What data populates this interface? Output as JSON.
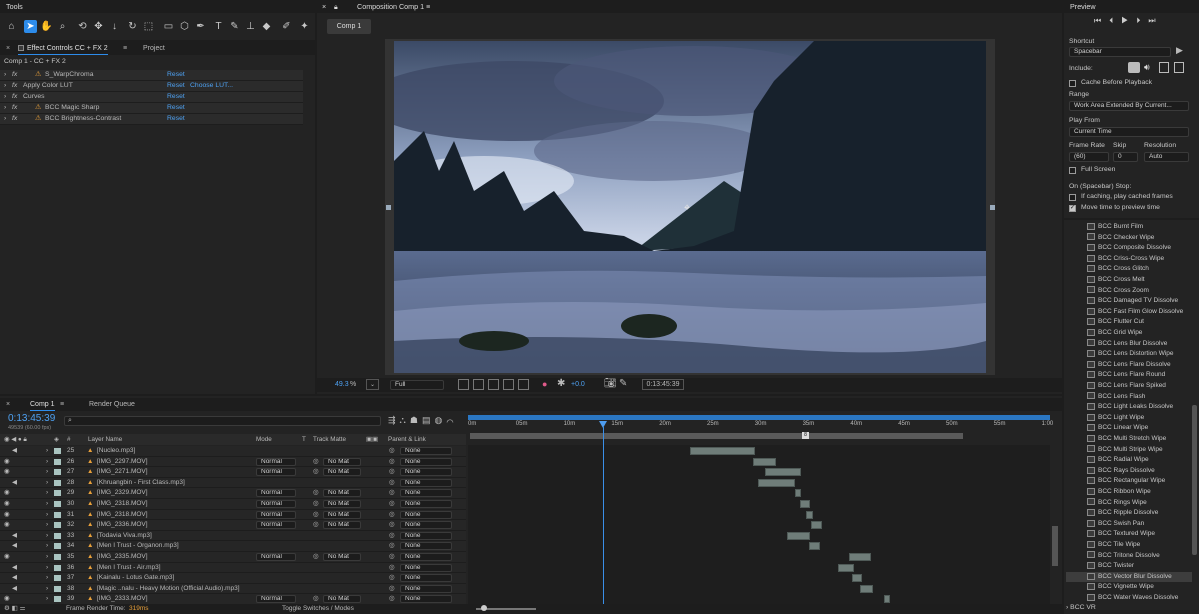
{
  "tools": {
    "title": "Tools"
  },
  "effect_controls": {
    "close": "×",
    "tab": "Effect Controls CC + FX 2",
    "menu": "≡",
    "project_tab": "Project",
    "breadcrumb": "Comp 1 - CC + FX 2",
    "effects": [
      {
        "name": "S_WarpChroma",
        "warn": true,
        "reset": "Reset",
        "extra": ""
      },
      {
        "name": "Apply Color LUT",
        "warn": false,
        "reset": "Reset",
        "extra": "Choose LUT..."
      },
      {
        "name": "Curves",
        "warn": false,
        "reset": "Reset",
        "extra": ""
      },
      {
        "name": "BCC Magic Sharp",
        "warn": true,
        "reset": "Reset",
        "extra": ""
      },
      {
        "name": "BCC Brightness-Contrast",
        "warn": true,
        "reset": "Reset",
        "extra": ""
      }
    ]
  },
  "composition": {
    "tab": "Composition Comp 1",
    "menu": "≡",
    "subtab": "Comp 1",
    "zoom": "49.3",
    "zoom_unit": "%",
    "resolution": "Full",
    "exposure": "+0.0",
    "timecode": "0:13:45:39"
  },
  "preview": {
    "title": "Preview",
    "shortcut_label": "Shortcut",
    "shortcut_value": "Spacebar",
    "include_label": "Include:",
    "cache_label": "Cache Before Playback",
    "range_label": "Range",
    "range_value": "Work Area Extended By Current...",
    "play_from_label": "Play From",
    "play_from_value": "Current Time",
    "frame_rate_label": "Frame Rate",
    "skip_label": "Skip",
    "resolution_label": "Resolution",
    "frame_rate_value": "(60)",
    "skip_value": "0",
    "resolution_value": "Auto",
    "full_screen_label": "Full Screen",
    "on_stop_label": "On (Spacebar) Stop:",
    "if_caching_label": "If caching, play cached frames",
    "move_time_label": "Move time to preview time",
    "cache_checked": false,
    "full_screen_checked": false,
    "if_caching_checked": false,
    "move_time_checked": true
  },
  "effects_list": {
    "items": [
      "BCC Burnt Film",
      "BCC Checker Wipe",
      "BCC Composite Dissolve",
      "BCC Criss-Cross Wipe",
      "BCC Cross Glitch",
      "BCC Cross Melt",
      "BCC Cross Zoom",
      "BCC Damaged TV Dissolve",
      "BCC Fast Film Glow Dissolve",
      "BCC Flutter Cut",
      "BCC Grid Wipe",
      "BCC Lens Blur Dissolve",
      "BCC Lens Distortion Wipe",
      "BCC Lens Flare Dissolve",
      "BCC Lens Flare Round",
      "BCC Lens Flare Spiked",
      "BCC Lens Flash",
      "BCC Light Leaks Dissolve",
      "BCC Light Wipe",
      "BCC Linear Wipe",
      "BCC Multi Stretch Wipe",
      "BCC Multi Stripe Wipe",
      "BCC Radial Wipe",
      "BCC Rays Dissolve",
      "BCC Rectangular Wipe",
      "BCC Ribbon Wipe",
      "BCC Rings Wipe",
      "BCC Ripple Dissolve",
      "BCC Swish Pan",
      "BCC Textured Wipe",
      "BCC Tile Wipe",
      "BCC Tritone Dissolve",
      "BCC Twister",
      "BCC Vector Blur Dissolve",
      "BCC Vignette Wipe",
      "BCC Water Waves Dissolve"
    ],
    "selected": "BCC Vector Blur Dissolve",
    "footer": "BCC VR"
  },
  "timeline": {
    "close": "×",
    "tab": "Comp 1",
    "menu": "≡",
    "render_queue_tab": "Render Queue",
    "timecode": "0:13:45:39",
    "fps": "49539 (60.00 fps)",
    "search_placeholder": "",
    "col_hash": "#",
    "col_layer_name": "Layer Name",
    "col_mode": "Mode",
    "col_t": "T",
    "col_track_matte": "Track Matte",
    "col_parent": "Parent & Link",
    "ruler": [
      "0m",
      "05m",
      "10m",
      "15m",
      "20m",
      "25m",
      "30m",
      "35m",
      "40m",
      "45m",
      "50m",
      "55m",
      "1:00"
    ],
    "footer_render_label": "Frame Render Time:",
    "footer_render_value": "319ms",
    "footer_toggle": "Toggle Switches / Modes",
    "layers": [
      {
        "num": "25",
        "name": "[Nucleo.mp3]",
        "audio": true,
        "video": false,
        "mode": "",
        "matte": "",
        "parent": "None",
        "start": 0.203,
        "end": 0.263
      },
      {
        "num": "26",
        "name": "[IMG_2297.MOV]",
        "audio": false,
        "video": true,
        "mode": "Normal",
        "matte": "No Mat",
        "parent": "None",
        "start": 0.261,
        "end": 0.283
      },
      {
        "num": "27",
        "name": "[IMG_2271.MOV]",
        "audio": false,
        "video": true,
        "mode": "Normal",
        "matte": "No Mat",
        "parent": "None",
        "start": 0.272,
        "end": 0.306
      },
      {
        "num": "28",
        "name": "[Khruangbin - First Class.mp3]",
        "audio": true,
        "video": false,
        "mode": "",
        "matte": "",
        "parent": "None",
        "start": 0.266,
        "end": 0.3
      },
      {
        "num": "29",
        "name": "[IMG_2329.MOV]",
        "audio": false,
        "video": true,
        "mode": "Normal",
        "matte": "No Mat",
        "parent": "None",
        "start": 0.3,
        "end": 0.305
      },
      {
        "num": "30",
        "name": "[IMG_2318.MOV]",
        "audio": false,
        "video": true,
        "mode": "Normal",
        "matte": "No Mat",
        "parent": "None",
        "start": 0.305,
        "end": 0.314
      },
      {
        "num": "31",
        "name": "[IMG_2318.MOV]",
        "audio": false,
        "video": true,
        "mode": "Normal",
        "matte": "No Mat",
        "parent": "None",
        "start": 0.31,
        "end": 0.317
      },
      {
        "num": "32",
        "name": "[IMG_2336.MOV]",
        "audio": false,
        "video": true,
        "mode": "Normal",
        "matte": "No Mat",
        "parent": "None",
        "start": 0.315,
        "end": 0.325
      },
      {
        "num": "33",
        "name": "[Todavia Viva.mp3]",
        "audio": true,
        "video": false,
        "mode": "",
        "matte": "",
        "parent": "None",
        "start": 0.293,
        "end": 0.314
      },
      {
        "num": "34",
        "name": "[Men I Trust - Organon.mp3]",
        "audio": true,
        "video": false,
        "mode": "",
        "matte": "",
        "parent": "None",
        "start": 0.313,
        "end": 0.323
      },
      {
        "num": "35",
        "name": "[IMG_2335.MOV]",
        "audio": false,
        "video": true,
        "mode": "Normal",
        "matte": "No Mat",
        "parent": "None",
        "start": 0.35,
        "end": 0.37
      },
      {
        "num": "36",
        "name": "[Men I Trust - Air.mp3]",
        "audio": true,
        "video": false,
        "mode": "",
        "matte": "",
        "parent": "None",
        "start": 0.34,
        "end": 0.355
      },
      {
        "num": "37",
        "name": "[Kainalu - Lotus Gate.mp3]",
        "audio": true,
        "video": false,
        "mode": "",
        "matte": "",
        "parent": "None",
        "start": 0.353,
        "end": 0.362
      },
      {
        "num": "38",
        "name": "[Magic ..nalu - Heavy Motion (Official Audio).mp3]",
        "audio": true,
        "video": false,
        "mode": "",
        "matte": "",
        "parent": "None",
        "start": 0.36,
        "end": 0.372
      },
      {
        "num": "39",
        "name": "[IMG_2333.MOV]",
        "audio": false,
        "video": true,
        "mode": "Normal",
        "matte": "No Mat",
        "parent": "None",
        "start": 0.382,
        "end": 0.386
      }
    ]
  }
}
